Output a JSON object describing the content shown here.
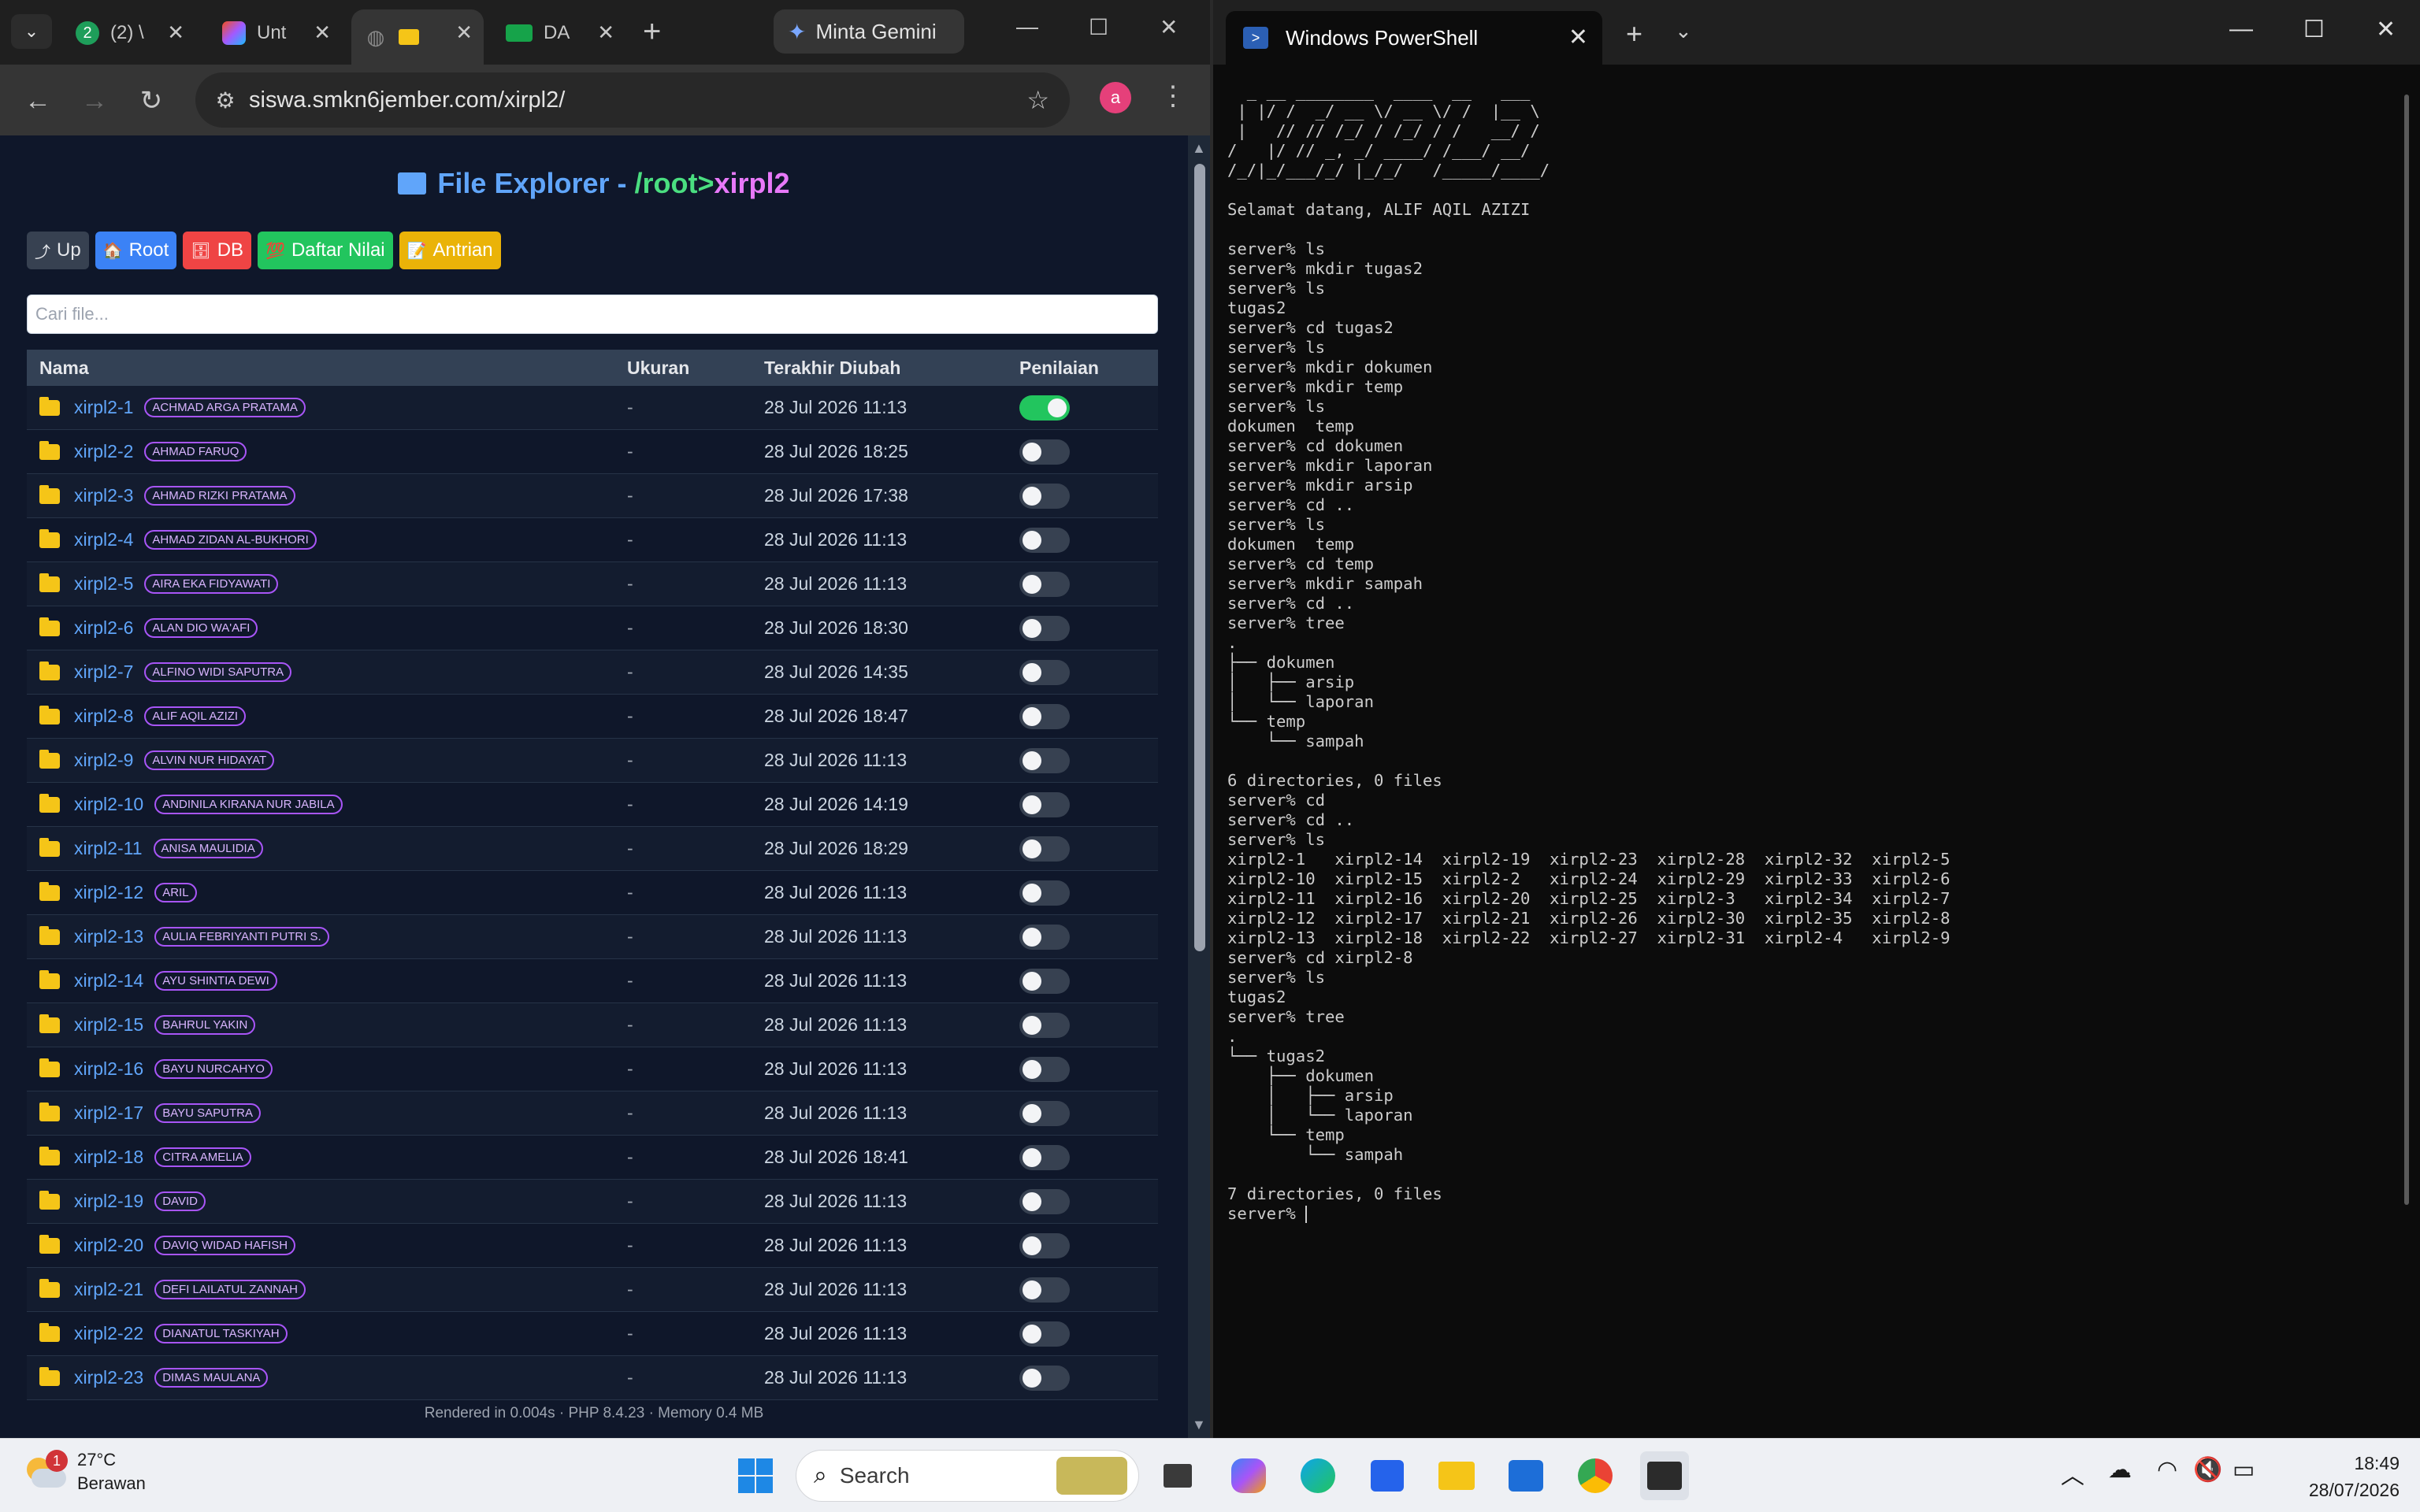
{
  "chrome": {
    "tabs": [
      {
        "label": "(2) \\",
        "badge": "2"
      },
      {
        "label": "Unt"
      },
      {
        "label": ""
      },
      {
        "label": "DA"
      }
    ],
    "gemini_label": "Minta Gemini",
    "url": "siswa.smkn6jember.com/xirpl2/",
    "profile_initial": "a"
  },
  "explorer": {
    "title_prefix": "File Explorer - ",
    "title_root": "/root",
    "title_sep": ">",
    "title_current": "xirpl2",
    "buttons": [
      {
        "label": "Up",
        "icon": "⤴"
      },
      {
        "label": "Root",
        "icon": "🏠"
      },
      {
        "label": "DB",
        "icon": "🗄"
      },
      {
        "label": "Daftar Nilai",
        "icon": "💯"
      },
      {
        "label": "Antrian",
        "icon": "📝"
      }
    ],
    "search_placeholder": "Cari file...",
    "columns": [
      "Nama",
      "Ukuran",
      "Terakhir Diubah",
      "Penilaian"
    ],
    "rows": [
      {
        "name": "xirpl2-1",
        "owner": "ACHMAD ARGA PRATAMA",
        "size": "-",
        "modified": "28 Jul 2026 11:13",
        "graded": true
      },
      {
        "name": "xirpl2-2",
        "owner": "AHMAD FARUQ",
        "size": "-",
        "modified": "28 Jul 2026 18:25",
        "graded": false
      },
      {
        "name": "xirpl2-3",
        "owner": "AHMAD RIZKI PRATAMA",
        "size": "-",
        "modified": "28 Jul 2026 17:38",
        "graded": false
      },
      {
        "name": "xirpl2-4",
        "owner": "AHMAD ZIDAN AL-BUKHORI",
        "size": "-",
        "modified": "28 Jul 2026 11:13",
        "graded": false
      },
      {
        "name": "xirpl2-5",
        "owner": "AIRA EKA FIDYAWATI",
        "size": "-",
        "modified": "28 Jul 2026 11:13",
        "graded": false
      },
      {
        "name": "xirpl2-6",
        "owner": "ALAN DIO WA'AFI",
        "size": "-",
        "modified": "28 Jul 2026 18:30",
        "graded": false
      },
      {
        "name": "xirpl2-7",
        "owner": "ALFINO WIDI SAPUTRA",
        "size": "-",
        "modified": "28 Jul 2026 14:35",
        "graded": false
      },
      {
        "name": "xirpl2-8",
        "owner": "ALIF AQIL AZIZI",
        "size": "-",
        "modified": "28 Jul 2026 18:47",
        "graded": false
      },
      {
        "name": "xirpl2-9",
        "owner": "ALVIN NUR HIDAYAT",
        "size": "-",
        "modified": "28 Jul 2026 11:13",
        "graded": false
      },
      {
        "name": "xirpl2-10",
        "owner": "ANDINILA KIRANA NUR JABILA",
        "size": "-",
        "modified": "28 Jul 2026 14:19",
        "graded": false
      },
      {
        "name": "xirpl2-11",
        "owner": "ANISA MAULIDIA",
        "size": "-",
        "modified": "28 Jul 2026 18:29",
        "graded": false
      },
      {
        "name": "xirpl2-12",
        "owner": "ARIL",
        "size": "-",
        "modified": "28 Jul 2026 11:13",
        "graded": false
      },
      {
        "name": "xirpl2-13",
        "owner": "AULIA FEBRIYANTI PUTRI S.",
        "size": "-",
        "modified": "28 Jul 2026 11:13",
        "graded": false
      },
      {
        "name": "xirpl2-14",
        "owner": "AYU SHINTIA DEWI",
        "size": "-",
        "modified": "28 Jul 2026 11:13",
        "graded": false
      },
      {
        "name": "xirpl2-15",
        "owner": "BAHRUL YAKIN",
        "size": "-",
        "modified": "28 Jul 2026 11:13",
        "graded": false
      },
      {
        "name": "xirpl2-16",
        "owner": "BAYU NURCAHYO",
        "size": "-",
        "modified": "28 Jul 2026 11:13",
        "graded": false
      },
      {
        "name": "xirpl2-17",
        "owner": "BAYU SAPUTRA",
        "size": "-",
        "modified": "28 Jul 2026 11:13",
        "graded": false
      },
      {
        "name": "xirpl2-18",
        "owner": "CITRA AMELIA",
        "size": "-",
        "modified": "28 Jul 2026 18:41",
        "graded": false
      },
      {
        "name": "xirpl2-19",
        "owner": "DAVID",
        "size": "-",
        "modified": "28 Jul 2026 11:13",
        "graded": false
      },
      {
        "name": "xirpl2-20",
        "owner": "DAVIQ WIDAD HAFISH",
        "size": "-",
        "modified": "28 Jul 2026 11:13",
        "graded": false
      },
      {
        "name": "xirpl2-21",
        "owner": "DEFI LAILATUL ZANNAH",
        "size": "-",
        "modified": "28 Jul 2026 11:13",
        "graded": false
      },
      {
        "name": "xirpl2-22",
        "owner": "DIANATUL TASKIYAH",
        "size": "-",
        "modified": "28 Jul 2026 11:13",
        "graded": false
      },
      {
        "name": "xirpl2-23",
        "owner": "DIMAS MAULANA",
        "size": "-",
        "modified": "28 Jul 2026 11:13",
        "graded": false
      }
    ],
    "footer": "Rendered in 0.004s · PHP 8.4.23 · Memory 0.4 MB"
  },
  "powershell": {
    "tab_title": "Windows PowerShell",
    "lines": [
      "  _ __ ________  ____  __   ___ ",
      " | |/ /  _/ __ \\/ __ \\/ /  |__ \\",
      " |   // // /_/ / /_/ / /   __/ /",
      "/   |/ // _, _/ ____/ /___/ __/ ",
      "/_/|_/___/_/ |_/_/   /_____/____/ ",
      "",
      "Selamat datang, ALIF AQIL AZIZI",
      "",
      "server% ls",
      "server% mkdir tugas2",
      "server% ls",
      "tugas2",
      "server% cd tugas2",
      "server% ls",
      "server% mkdir dokumen",
      "server% mkdir temp",
      "server% ls",
      "dokumen  temp",
      "server% cd dokumen",
      "server% mkdir laporan",
      "server% mkdir arsip",
      "server% cd ..",
      "server% ls",
      "dokumen  temp",
      "server% cd temp",
      "server% mkdir sampah",
      "server% cd ..",
      "server% tree",
      ".",
      "├── dokumen",
      "│   ├── arsip",
      "│   └── laporan",
      "└── temp",
      "    └── sampah",
      "",
      "6 directories, 0 files",
      "server% cd",
      "server% cd ..",
      "server% ls",
      "xirpl2-1   xirpl2-14  xirpl2-19  xirpl2-23  xirpl2-28  xirpl2-32  xirpl2-5",
      "xirpl2-10  xirpl2-15  xirpl2-2   xirpl2-24  xirpl2-29  xirpl2-33  xirpl2-6",
      "xirpl2-11  xirpl2-16  xirpl2-20  xirpl2-25  xirpl2-3   xirpl2-34  xirpl2-7",
      "xirpl2-12  xirpl2-17  xirpl2-21  xirpl2-26  xirpl2-30  xirpl2-35  xirpl2-8",
      "xirpl2-13  xirpl2-18  xirpl2-22  xirpl2-27  xirpl2-31  xirpl2-4   xirpl2-9",
      "server% cd xirpl2-8",
      "server% ls",
      "tugas2",
      "server% tree",
      ".",
      "└── tugas2",
      "    ├── dokumen",
      "    │   ├── arsip",
      "    │   └── laporan",
      "    └── temp",
      "        └── sampah",
      "",
      "7 directories, 0 files"
    ],
    "prompt": "server% "
  },
  "taskbar": {
    "weather_temp": "27°C",
    "weather_desc": "Berawan",
    "weather_notif": "1",
    "search_label": "Search",
    "time": "18:49",
    "date": "28/07/2026"
  }
}
